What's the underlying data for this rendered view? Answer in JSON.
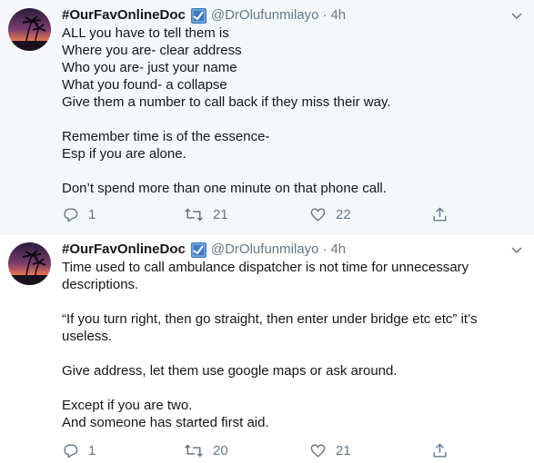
{
  "tweets": [
    {
      "author_name": "#OurFavOnlineDoc",
      "handle": "@DrOlufunmilayo",
      "separator": "·",
      "time": "4h",
      "lines": [
        "ALL you have to tell them is",
        "Where you are- clear address",
        "Who you are- just your name",
        "What you found- a collapse",
        "Give them a number to call back if they miss their way.",
        "",
        "Remember time is of the essence-",
        "Esp if you are alone.",
        "",
        "Don’t spend more than one minute on that phone call."
      ],
      "replies": "1",
      "retweets": "21",
      "likes": "22"
    },
    {
      "author_name": "#OurFavOnlineDoc",
      "handle": "@DrOlufunmilayo",
      "separator": "·",
      "time": "4h",
      "lines": [
        "Time used to call ambulance dispatcher is not time for unnecessary",
        "descriptions.",
        "",
        "“If you turn right, then go straight, then enter under bridge etc etc” it’s",
        "useless.",
        "",
        "Give address, let them use google maps or ask around.",
        "",
        "Except if you are two.",
        "And someone has started first aid."
      ],
      "replies": "1",
      "retweets": "20",
      "likes": "21"
    }
  ],
  "icons": {
    "reply": "reply-icon",
    "retweet": "retweet-icon",
    "like": "heart-icon",
    "share": "share-icon",
    "verified": "verified-badge-icon",
    "caret": "chevron-down-icon"
  },
  "colors": {
    "highlight_bg": "#f5f8fa",
    "secondary_text": "#657786",
    "badge": "#3b7cc5"
  }
}
